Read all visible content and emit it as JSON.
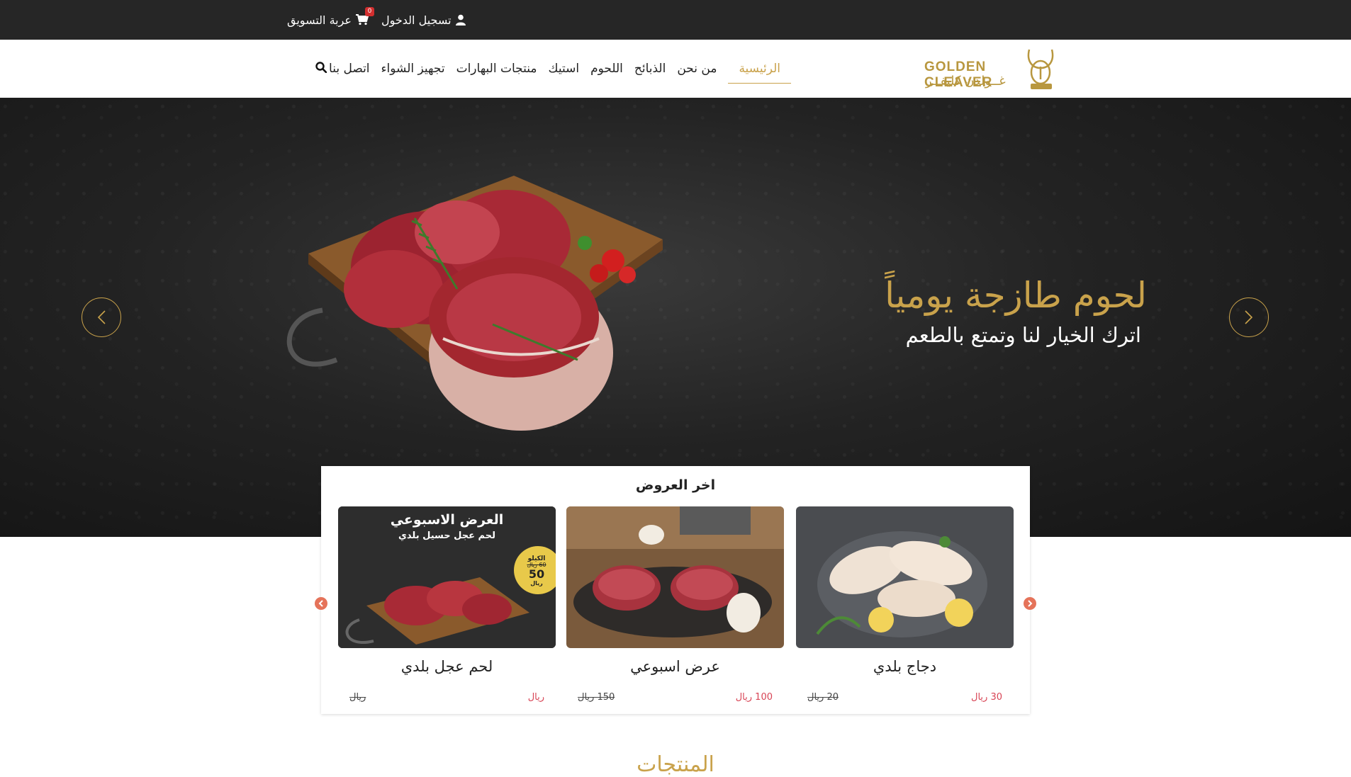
{
  "topbar": {
    "login_label": "تسجيل الدخول",
    "cart_label": "عربة التسويق",
    "cart_count": "0"
  },
  "logo": {
    "text_en": "GOLDEN CLEAVER",
    "text_ar": "غــولدن كليفــر"
  },
  "nav": {
    "items": [
      {
        "label": "الرئيسية",
        "active": true
      },
      {
        "label": "من نحن"
      },
      {
        "label": "الذبائح"
      },
      {
        "label": "اللحوم"
      },
      {
        "label": "استيك"
      },
      {
        "label": "منتجات البهارات"
      },
      {
        "label": "تجهيز الشواء"
      },
      {
        "label": "اتصل بنا"
      }
    ],
    "search_icon": "search-icon"
  },
  "hero": {
    "title": "لحوم طازجة يومياً",
    "subtitle": "اترك الخيار لنا وتمتع بالطعم"
  },
  "offers": {
    "title": "اخر العروض",
    "cards": [
      {
        "name": "دجاج بلدي",
        "price": "30 ريال",
        "old_price": "20 ريال"
      },
      {
        "name": "عرض اسبوعي",
        "price": "100 ريال",
        "old_price": "150 ريال"
      },
      {
        "name": "لحم عجل بلدي",
        "price": "ريال",
        "old_price": "ريال",
        "promo_title": "العرض الاسبوعي",
        "promo_sub": "لحم عجل حسيل بلدي",
        "promo_badge_1": "الكيلو",
        "promo_badge_2": "60 ريال",
        "promo_badge_3": "50",
        "promo_badge_4": "ريال"
      }
    ]
  },
  "products_heading": "المنتجات",
  "colors": {
    "gold": "#c9a24b",
    "topbar": "#262626",
    "price_red": "#d84455"
  }
}
